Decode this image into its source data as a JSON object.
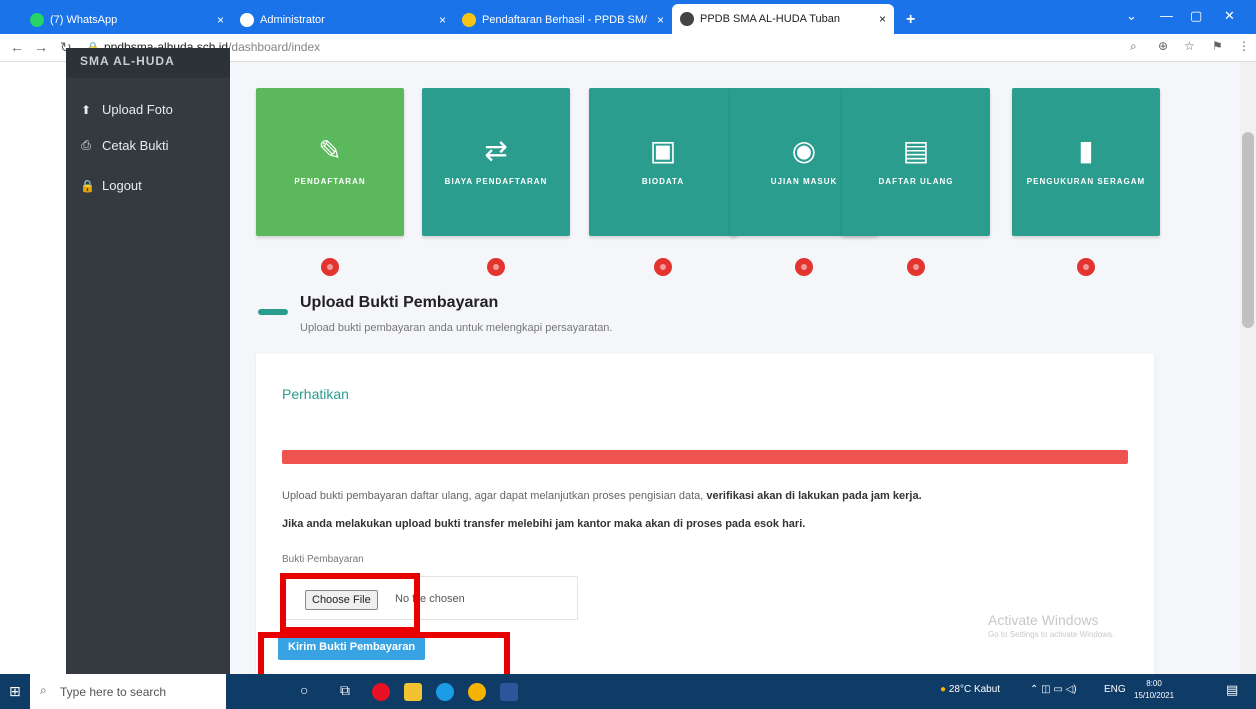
{
  "browser": {
    "tabs": [
      {
        "label": "(7) WhatsApp",
        "color": "#25d366"
      },
      {
        "label": "Administrator",
        "color": "#ffffff"
      },
      {
        "label": "Pendaftaran Berhasil - PPDB SM/",
        "color": "#f5c518"
      },
      {
        "label": "PPDB SMA AL-HUDA Tuban",
        "color": "#444444"
      }
    ],
    "new_tab": "+",
    "close_tab": "×",
    "url_host": "ppdbsma-alhuda.sch.id",
    "url_path": "/dashboard/index"
  },
  "sidebar": {
    "header": "SMA AL-HUDA",
    "items": [
      {
        "icon": "upload-icon",
        "glyph": "⬆",
        "label": "Upload Foto"
      },
      {
        "icon": "print-icon",
        "glyph": "⎙",
        "label": "Cetak Bukti"
      },
      {
        "icon": "lock-icon",
        "glyph": "🔒",
        "label": "Logout"
      }
    ]
  },
  "steps": [
    {
      "glyph": "✎",
      "icon": "edit-icon",
      "label": "PENDAFTARAN",
      "status": "done"
    },
    {
      "glyph": "⇄",
      "icon": "exchange-icon",
      "label": "BIAYA PENDAFTARAN",
      "status": "pending"
    },
    {
      "glyph": "▣",
      "icon": "id-card-icon",
      "label": "BIODATA",
      "status": "pending"
    },
    {
      "glyph": "◉",
      "icon": "book-globe-icon",
      "label": "UJIAN MASUK",
      "status": "pending"
    },
    {
      "glyph": "▤",
      "icon": "contact-book-icon",
      "label": "DAFTAR ULANG",
      "status": "pending"
    },
    {
      "glyph": "▮",
      "icon": "ruler-icon",
      "label": "PENGUKURAN SERAGAM",
      "status": "pending"
    }
  ],
  "section": {
    "title": "Upload Bukti Pembayaran",
    "subtitle": "Upload bukti pembayaran anda untuk melengkapi persayaratan."
  },
  "card": {
    "title": "Perhatikan",
    "notice_prefix": "Upload bukti pembayaran daftar ulang, agar dapat melanjutkan proses pengisian data, ",
    "notice_bold": "verifikasi akan di lakukan pada jam kerja.",
    "notice2": "Jika anda melakukan upload bukti transfer melebihi jam kantor maka akan di proses pada esok hari.",
    "field_label": "Bukti Pembayaran",
    "choose_file": "Choose File",
    "no_file": "No file chosen",
    "submit": "Kirim Bukti Pembayaran"
  },
  "watermark": {
    "line1": "Activate Windows",
    "line2": "Go to Settings to activate Windows."
  },
  "taskbar": {
    "search_placeholder": "Type here to search",
    "weather": "28°C Kabut",
    "lang": "ENG",
    "time": "8:00",
    "date": "15/10/2021"
  },
  "colors": {
    "accent_teal": "#2a9d8f",
    "done_green": "#5cb85c",
    "alert_red": "#ef5350",
    "submit_blue": "#38a3e3",
    "highlight_box": "#e80000"
  }
}
